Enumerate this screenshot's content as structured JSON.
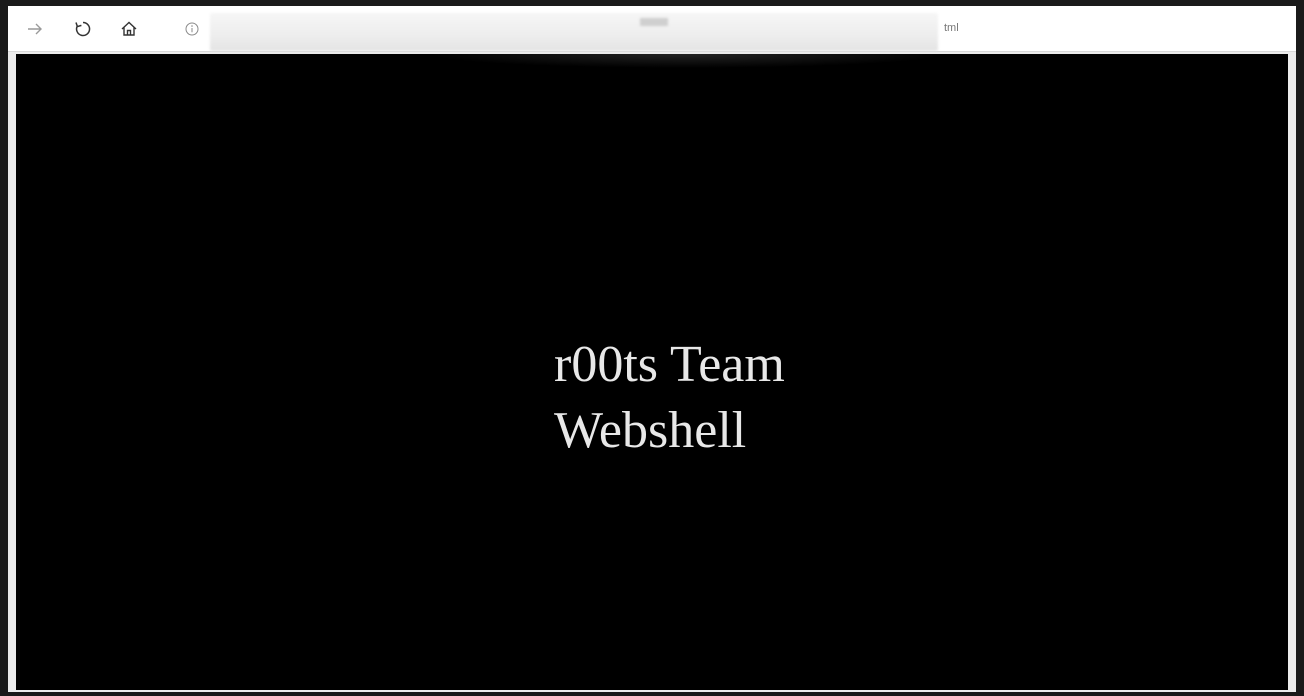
{
  "browser": {
    "back_icon": "arrow-right-icon",
    "refresh_icon": "refresh-icon",
    "home_icon": "home-icon",
    "address_bar": {
      "info_icon": "info-icon",
      "url_suffix": "tml"
    }
  },
  "page": {
    "background": "#000000",
    "text_color": "#e8e8e8",
    "line1": "r00ts Team",
    "line2": "Webshell"
  }
}
